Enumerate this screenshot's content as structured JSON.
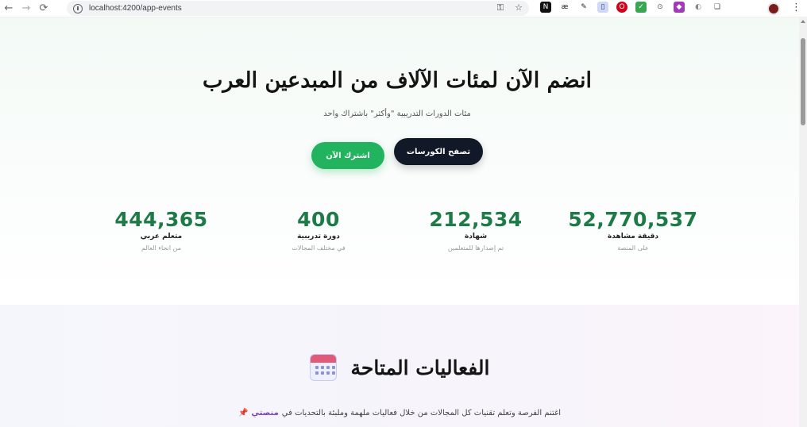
{
  "browser": {
    "url": "localhost:4200/app-events",
    "back_icon": "arrow-left",
    "forward_icon": "arrow-right",
    "extensions": [
      "N",
      "æ",
      "✎",
      "▯",
      "O",
      "✓",
      "⊙",
      "◆",
      "◐",
      "❏"
    ]
  },
  "hero": {
    "title": "انضم الآن لمئات الآلاف من المبدعين العرب",
    "subtitle": "مئات الدورات التدريبية \"وأكثر\" باشتراك واحد",
    "browse_button": "تصفح الكورسات",
    "subscribe_button": "اشترك الآن",
    "stats": [
      {
        "value": "52,770,537",
        "label": "دقيقة مشاهدة",
        "sub": "على المنصة"
      },
      {
        "value": "212,534",
        "label": "شهادة",
        "sub": "تم إصدارها للمتعلمين"
      },
      {
        "value": "400",
        "label": "دورة تدريبية",
        "sub": "في مختلف المجالات"
      },
      {
        "value": "444,365",
        "label": "متعلم عربي",
        "sub": "من انحاء العالم"
      }
    ]
  },
  "events": {
    "title": "الفعاليات المتاحة",
    "icon": "calendar-icon",
    "subtitle_text": "اغتنم الفرصة وتعلم تقنيات كل المجالات من خلال فعاليات ملهمة وملبئة بالتحديات في",
    "subtitle_brand": "منصتي"
  },
  "colors": {
    "accent_green": "#22b35e",
    "stat_green": "#1e7a47",
    "dark_button": "#111827",
    "brand_purple": "#7b3fb8"
  }
}
